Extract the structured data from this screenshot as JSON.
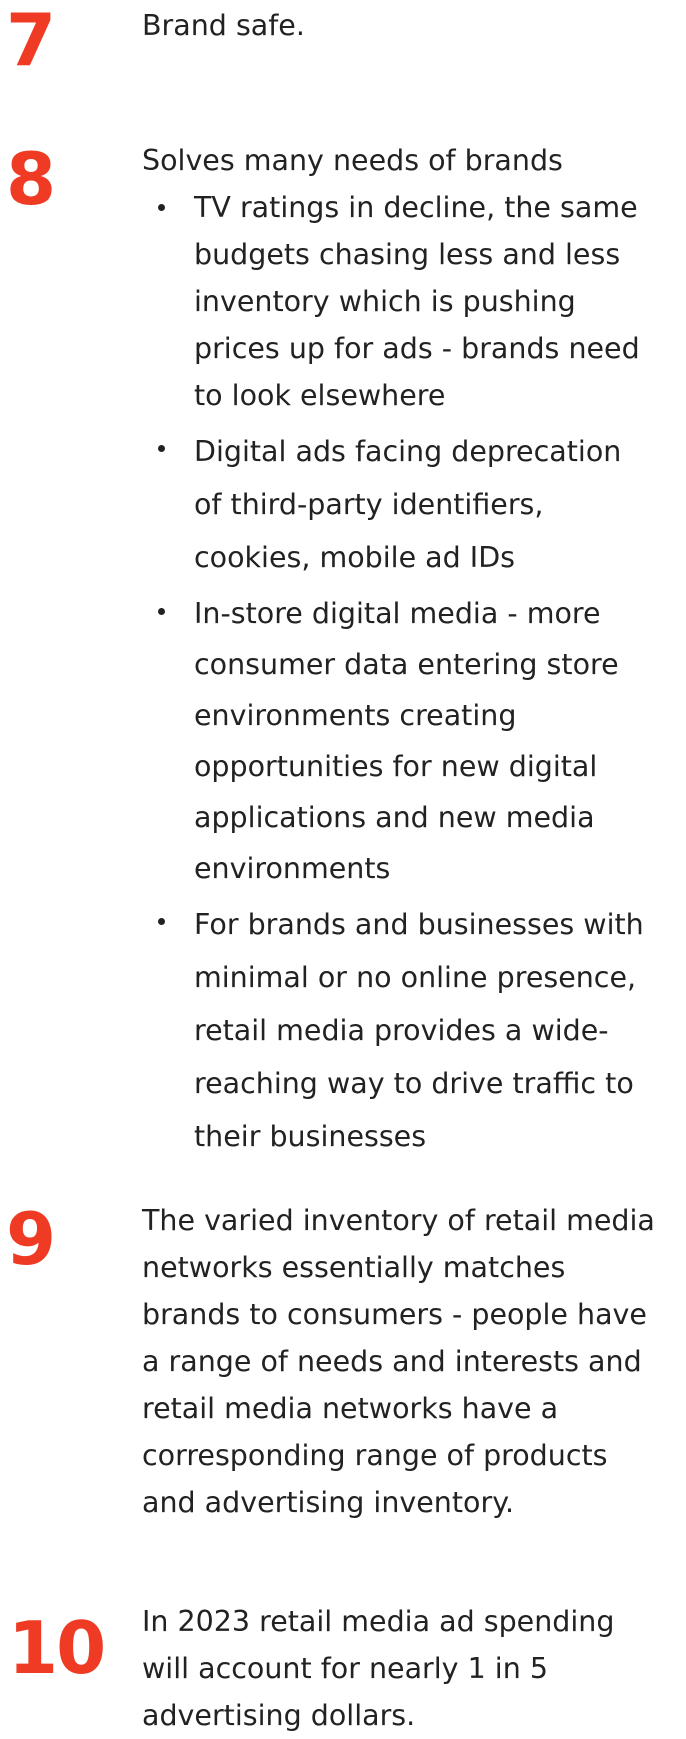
{
  "items": [
    {
      "number": "7",
      "text": "Brand safe."
    },
    {
      "number": "8",
      "text": "Solves many needs of brands",
      "bullets": [
        "TV ratings in decline, the same budgets chasing less and less inventory which is pushing prices up for ads - brands need to look elsewhere",
        "Digital ads facing deprecation of third-party identifiers, cookies, mobile ad IDs",
        "In-store digital media - more consumer data entering store environments creating opportunities for new digital applications and new media environments",
        "For brands and businesses with minimal or no online presence, retail media provides a wide-reaching way to drive traffic to their businesses"
      ]
    },
    {
      "number": "9",
      "text": "The varied inventory of retail media networks essentially matches brands to consumers - people have a range of needs and interests and retail media networks have a corresponding range of products and advertising inventory."
    },
    {
      "number": "10",
      "text": "In 2023 retail media ad spending will account for nearly 1 in 5 advertising dollars."
    }
  ],
  "colors": {
    "accent": "#ef3b24",
    "text": "#222222",
    "background": "#ffffff"
  }
}
